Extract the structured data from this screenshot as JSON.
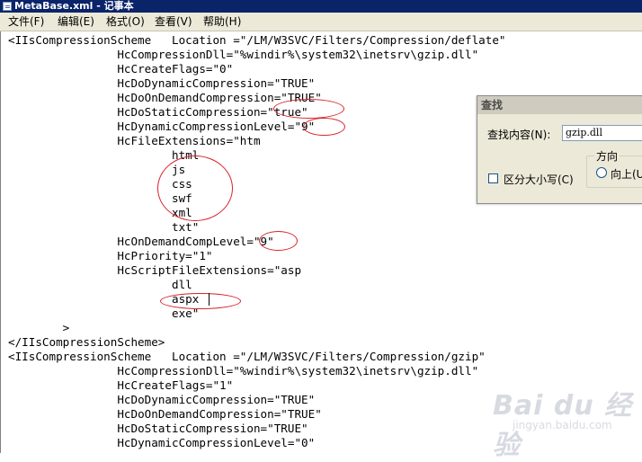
{
  "window": {
    "title": "MetaBase.xml - 记事本"
  },
  "menu": [
    {
      "label": "文件(F)"
    },
    {
      "label": "编辑(E)"
    },
    {
      "label": "格式(O)"
    },
    {
      "label": "查看(V)"
    },
    {
      "label": "帮助(H)"
    }
  ],
  "editor": {
    "lines": [
      "<IIsCompressionScheme\tLocation =\"/LM/W3SVC/Filters/Compression/deflate\"",
      "\t\tHcCompressionDll=\"%windir%\\system32\\inetsrv\\gzip.dll\"",
      "\t\tHcCreateFlags=\"0\"",
      "\t\tHcDoDynamicCompression=\"TRUE\"",
      "\t\tHcDoOnDemandCompression=\"TRUE\"",
      "\t\tHcDoStaticCompression=\"true\"",
      "\t\tHcDynamicCompressionLevel=\"9\"",
      "\t\tHcFileExtensions=\"htm",
      "\t\t\thtml",
      "\t\t\tjs",
      "\t\t\tcss",
      "\t\t\tswf",
      "\t\t\txml",
      "\t\t\ttxt\"",
      "\t\tHcOnDemandCompLevel=\"9\"",
      "\t\tHcPriority=\"1\"",
      "\t\tHcScriptFileExtensions=\"asp",
      "\t\t\tdll",
      "\t\t\taspx",
      "\t\t\texe\"",
      "\t>",
      "</IIsCompressionScheme>",
      "<IIsCompressionScheme\tLocation =\"/LM/W3SVC/Filters/Compression/gzip\"",
      "\t\tHcCompressionDll=\"%windir%\\system32\\inetsrv\\gzip.dll\"",
      "\t\tHcCreateFlags=\"1\"",
      "\t\tHcDoDynamicCompression=\"TRUE\"",
      "\t\tHcDoOnDemandCompression=\"TRUE\"",
      "\t\tHcDoStaticCompression=\"TRUE\"",
      "\t\tHcDynamicCompressionLevel=\"0\""
    ]
  },
  "find_dialog": {
    "title": "查找",
    "find_label": "查找内容(N):",
    "find_value": "gzip.dll",
    "match_case_label": "区分大小写(C)",
    "direction_label": "方向",
    "up_label": "向上(U)"
  },
  "watermark": {
    "brand": "Bai du 经验",
    "url": "jingyan.baidu.com"
  },
  "colors": {
    "highlight": "#d9222a",
    "titlebar": "#0a246a",
    "dialog_bg": "#ece9d8"
  }
}
